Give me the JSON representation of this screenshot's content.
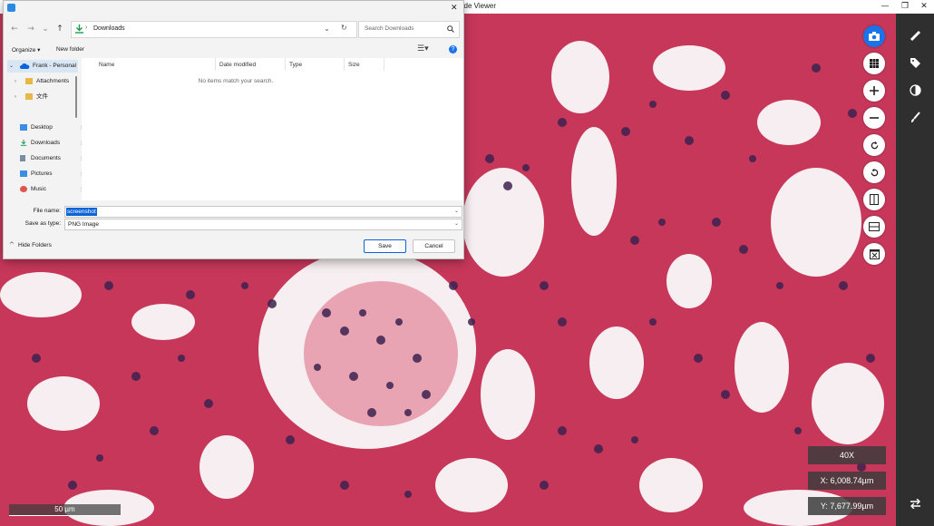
{
  "viewer": {
    "title": "lide Viewer",
    "window_controls": [
      "—",
      "❐",
      "✕"
    ],
    "scale_bar": "50 µm",
    "magnification": "40X",
    "x_readout": "X: 6,008.74µm",
    "y_readout": "Y: 7,677.99µm",
    "tools": [
      "camera-icon",
      "grid-icon",
      "zoom-in-icon",
      "zoom-out-icon",
      "rotate-right-icon",
      "rotate-left-icon",
      "flip-vertical-icon",
      "flip-horizontal-icon",
      "close-view-icon"
    ],
    "rail_tools": [
      "ruler-icon",
      "tag-icon",
      "contrast-icon",
      "brush-icon",
      "swap-icon"
    ],
    "colors": {
      "tissue": "#c93a5c",
      "background": "#f6eef0",
      "rail": "#2f2f2f",
      "accent": "#1a73e8"
    }
  },
  "dialog": {
    "address": "Downloads",
    "search_placeholder": "Search Downloads",
    "organize": "Organize ▾",
    "new_folder": "New folder",
    "nav": {
      "onedrive": "Frank - Personal",
      "attachments": "Attachments",
      "chinese_folder": "文件",
      "desktop": "Desktop",
      "downloads": "Downloads",
      "documents": "Documents",
      "pictures": "Pictures",
      "music": "Music"
    },
    "columns": [
      "Name",
      "Date modified",
      "Type",
      "Size"
    ],
    "empty_message": "No items match your search.",
    "file_name_label": "File name:",
    "file_name_value": "screenshot",
    "save_type_label": "Save as type:",
    "save_type_value": "PNG Image",
    "hide_folders": "Hide Folders",
    "save": "Save",
    "cancel": "Cancel"
  }
}
